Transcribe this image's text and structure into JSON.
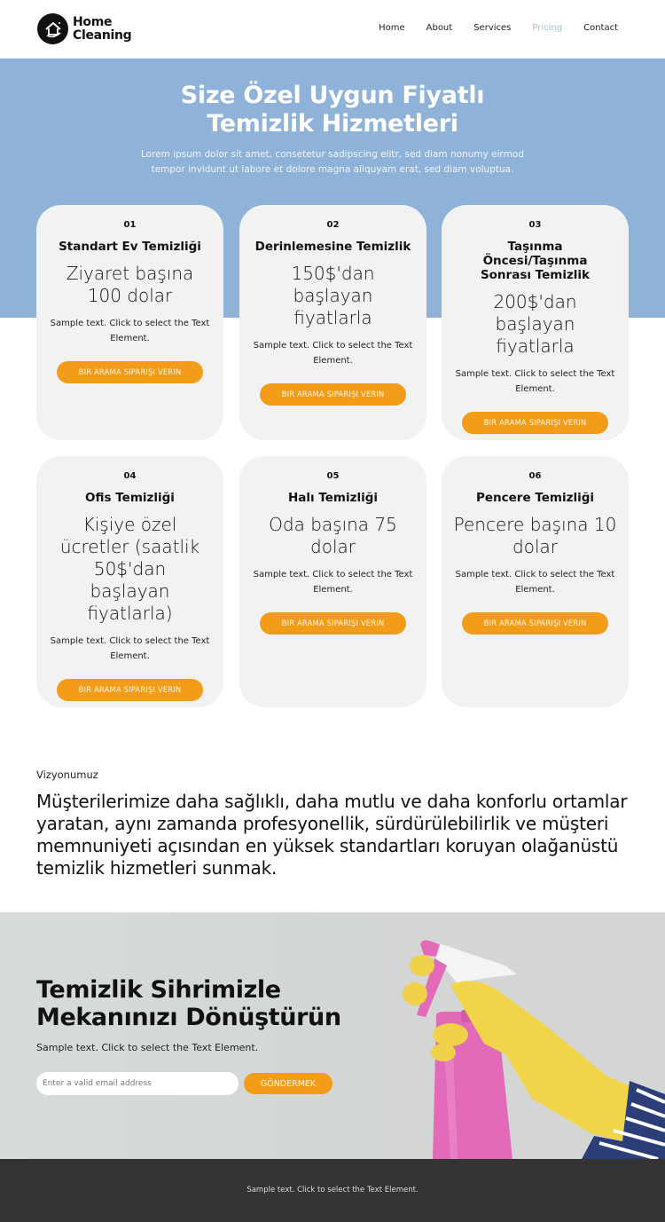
{
  "header": {
    "logo_line1": "Home",
    "logo_line2": "Cleaning",
    "nav": [
      {
        "label": "Home",
        "active": false
      },
      {
        "label": "About",
        "active": false
      },
      {
        "label": "Services",
        "active": false
      },
      {
        "label": "Pricing",
        "active": true
      },
      {
        "label": "Contact",
        "active": false
      }
    ]
  },
  "hero": {
    "title_line1": "Size Özel Uygun Fiyatlı",
    "title_line2": "Temizlik Hizmetleri",
    "subtitle_line1": "Lorem ipsum dolor sit amet, consetetur sadipscing elitr, sed diam nonumy eirmod",
    "subtitle_line2": "tempor invidunt ut labore et dolore magna aliquyam erat, sed diam voluptua.",
    "background_color": "#8fb2d8"
  },
  "cards": [
    {
      "number": "01",
      "title": "Standart Ev Temizliği",
      "price": "Ziyaret başına 100 dolar",
      "description": "Sample text. Click to select the Text Element.",
      "button": "BIR ARAMA SIPARIŞI VERIN"
    },
    {
      "number": "02",
      "title": "Derinlemesine Temizlik",
      "price": "150$'dan başlayan fiyatlarla",
      "description": "Sample text. Click to select the Text Element.",
      "button": "BIR ARAMA SIPARIŞI VERIN"
    },
    {
      "number": "03",
      "title": "Taşınma Öncesi/Taşınma Sonrası Temizlik",
      "price": "200$'dan başlayan fiyatlarla",
      "description": "Sample text. Click to select the Text Element.",
      "button": "BIR ARAMA SIPARIŞI VERIN"
    },
    {
      "number": "04",
      "title": "Ofis Temizliği",
      "price": "Kişiye özel ücretler (saatlik 50$'dan başlayan fiyatlarla)",
      "description": "Sample text. Click to select the Text Element.",
      "button": "BIR ARAMA SIPARIŞI VERIN"
    },
    {
      "number": "05",
      "title": "Halı Temizliği",
      "price": "Oda başına 75 dolar",
      "description": "Sample text. Click to select the Text Element.",
      "button": "BIR ARAMA SIPARIŞI VERIN"
    },
    {
      "number": "06",
      "title": "Pencere Temizliği",
      "price": "Pencere başına 10 dolar",
      "description": "Sample text. Click to select the Text Element.",
      "button": "BIR ARAMA SIPARIŞI VERIN"
    }
  ],
  "vision": {
    "label": "Vizyonumuz",
    "text": "Müşterilerimize daha sağlıklı, daha mutlu ve daha konforlu ortamlar yaratan, aynı zamanda profesyonellik, sürdürülebilirlik ve müşteri memnuniyeti açısından en yüksek standartları koruyan olağanüstü temizlik hizmetleri sunmak."
  },
  "cta": {
    "title_line1": "Temizlik Sihrimizle",
    "title_line2": "Mekanınızı Dönüştürün",
    "subtitle": "Sample text. Click to select the Text Element.",
    "email_placeholder": "Enter a valid email address",
    "email_value": "",
    "submit_label": "GÖNDERMEK",
    "image_icon": "spray-bottle-gloved-hand-photo"
  },
  "footer": {
    "text": "Sample text. Click to select the Text Element."
  },
  "colors": {
    "accent": "#f39c1a",
    "hero_blue": "#8fb2d8",
    "card_bg": "#f2f2f2",
    "footer_bg": "#333333",
    "nav_active": "#a9bfd1"
  }
}
